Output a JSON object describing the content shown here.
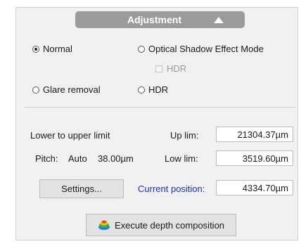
{
  "header": {
    "title": "Adjustment",
    "collapse_icon": "triangle-up-icon"
  },
  "modes": {
    "normal": {
      "label": "Normal",
      "selected": true
    },
    "optical_shadow": {
      "label": "Optical Shadow Effect Mode",
      "selected": false
    },
    "hdr_check": {
      "label": "HDR",
      "checked": false,
      "enabled": false
    },
    "glare_removal": {
      "label": "Glare removal",
      "selected": false
    },
    "hdr_radio": {
      "label": "HDR",
      "selected": false
    }
  },
  "limits": {
    "section_label": "Lower to upper limit",
    "pitch_label": "Pitch:",
    "pitch_mode": "Auto",
    "pitch_value": "38.00µm",
    "up_label": "Up lim:",
    "up_value": "21304.37µm",
    "low_label": "Low lim:",
    "low_value": "3519.60µm",
    "current_label": "Current position:",
    "current_value": "4334.70µm",
    "accent_color": "#1c2cc8"
  },
  "buttons": {
    "settings": "Settings...",
    "execute": "Execute depth composition",
    "execute_icon": "layers-icon"
  }
}
